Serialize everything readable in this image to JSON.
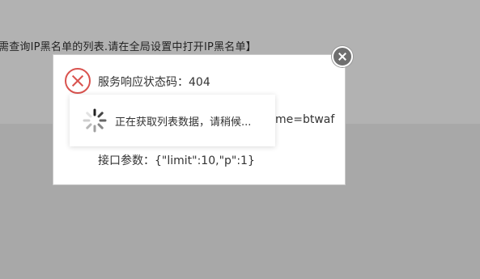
{
  "background": {
    "notice": "需查询IP黑名单的列表.请在全局设置中打开IP黑名单】"
  },
  "dialog": {
    "status_label": "服务响应状态码：404",
    "url_suffix": "me=btwaf",
    "params_label": "接口参数：{\"limit\":10,\"p\":1}"
  },
  "loading": {
    "text": "正在获取列表数据，请稍候..."
  },
  "icons": [
    "error-icon",
    "close-icon",
    "spinner-icon"
  ],
  "colors": {
    "error": "#d9534f",
    "close_bg": "#6f6f6f"
  }
}
